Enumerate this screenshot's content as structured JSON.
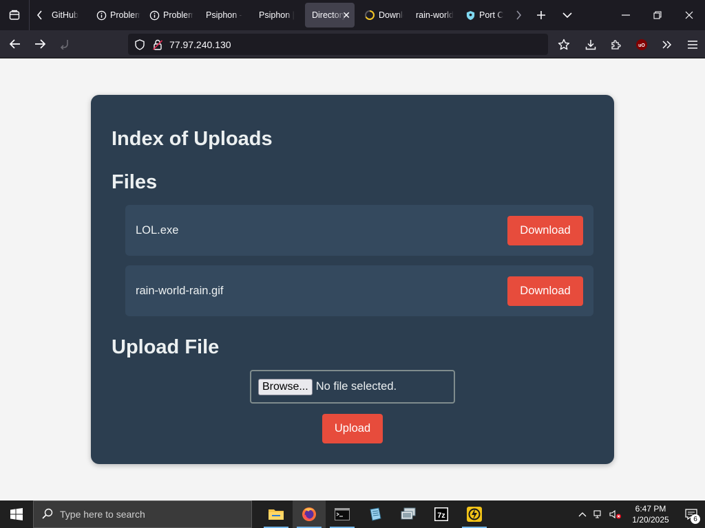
{
  "browser": {
    "tabs": [
      {
        "label": "GitHub",
        "icon": "github-icon",
        "active": false
      },
      {
        "label": "Problem",
        "icon": "info-icon",
        "active": false
      },
      {
        "label": "Problem",
        "icon": "info-icon",
        "active": false
      },
      {
        "label": "Psiphon -",
        "icon": "",
        "active": false
      },
      {
        "label": "Psiphon |",
        "icon": "",
        "active": false
      },
      {
        "label": "Directory",
        "icon": "",
        "active": true
      },
      {
        "label": "Download",
        "icon": "loading-spinner-icon",
        "active": false
      },
      {
        "label": "rain-world",
        "icon": "",
        "active": false
      },
      {
        "label": "Port C",
        "icon": "shield-icon",
        "active": false
      }
    ],
    "url": "77.97.240.130"
  },
  "page": {
    "title": "Index of Uploads",
    "files_heading": "Files",
    "files": [
      {
        "name": "LOL.exe",
        "action": "Download"
      },
      {
        "name": "rain-world-rain.gif",
        "action": "Download"
      }
    ],
    "upload_heading": "Upload File",
    "browse_label": "Browse...",
    "no_file_text": "No file selected.",
    "upload_label": "Upload"
  },
  "taskbar": {
    "search_placeholder": "Type here to search",
    "time": "6:47 PM",
    "date": "1/20/2025",
    "notification_count": "6"
  },
  "colors": {
    "panel": "#2c3e50",
    "file_row": "#34495e",
    "accent_red": "#e74c3c",
    "page_bg": "#f4f4f4"
  }
}
